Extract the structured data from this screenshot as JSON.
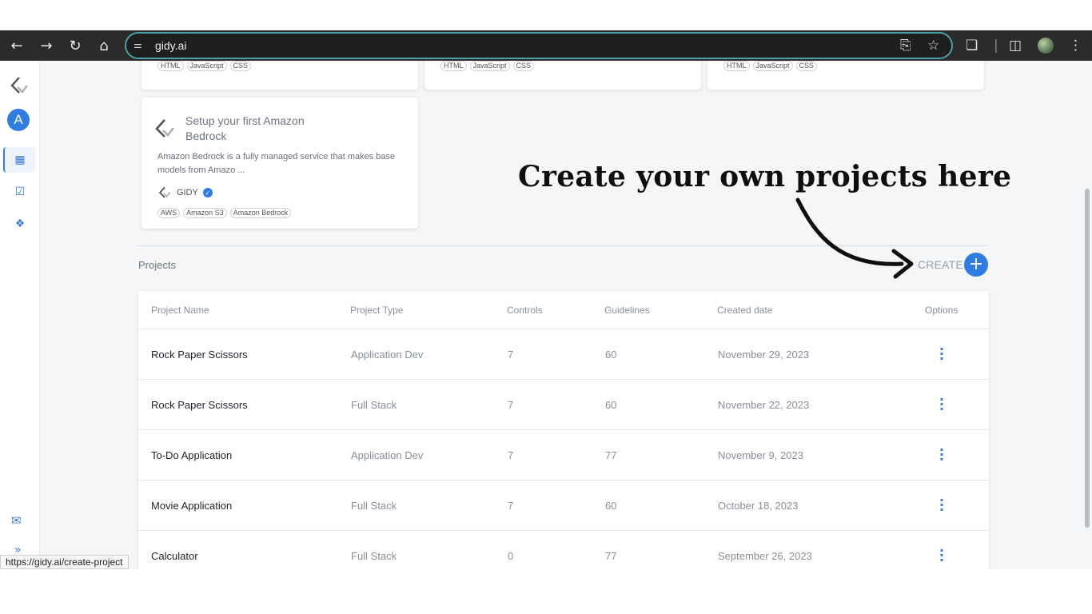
{
  "browser": {
    "url": "gidy.ai",
    "status_url": "https://gidy.ai/create-project"
  },
  "sidebar": {
    "avatar_letter": "A",
    "items": [
      {
        "icon": "dashboard-icon"
      },
      {
        "icon": "checklist-icon"
      },
      {
        "icon": "ai-brain-icon"
      },
      {
        "icon": "chat-icon"
      },
      {
        "icon": "expand-icon"
      }
    ]
  },
  "top_cards": [
    {
      "tags": [
        "HTML",
        "JavaScript",
        "CSS"
      ]
    },
    {
      "tags": [
        "HTML",
        "JavaScript",
        "CSS"
      ]
    },
    {
      "tags": [
        "HTML",
        "JavaScript",
        "CSS"
      ]
    }
  ],
  "feature_card": {
    "title": "Setup your first Amazon Bedrock",
    "description": "Amazon Bedrock is a fully managed service that makes base models from Amazo ...",
    "author": "GIDY",
    "tags": [
      "AWS",
      "Amazon S3",
      "Amazon Bedrock"
    ]
  },
  "projects": {
    "section_label": "Projects",
    "create_label": "CREATE",
    "columns": [
      "Project Name",
      "Project Type",
      "Controls",
      "Guidelines",
      "Created date",
      "Options"
    ],
    "rows": [
      {
        "name": "Rock Paper Scissors",
        "type": "Application Dev",
        "controls": "7",
        "guidelines": "60",
        "created": "November 29, 2023"
      },
      {
        "name": "Rock Paper Scissors",
        "type": "Full Stack",
        "controls": "7",
        "guidelines": "60",
        "created": "November 22, 2023"
      },
      {
        "name": "To-Do Application",
        "type": "Application Dev",
        "controls": "7",
        "guidelines": "77",
        "created": "November 9, 2023"
      },
      {
        "name": "Movie Application",
        "type": "Full Stack",
        "controls": "7",
        "guidelines": "60",
        "created": "October 18, 2023"
      },
      {
        "name": "Calculator",
        "type": "Full Stack",
        "controls": "0",
        "guidelines": "77",
        "created": "September 26, 2023"
      }
    ]
  },
  "annotation": {
    "text": "Create your own projects here"
  },
  "colors": {
    "accent": "#2f7de1",
    "chrome_bg": "#2b2b2b",
    "app_bg": "#f5f6f8"
  }
}
